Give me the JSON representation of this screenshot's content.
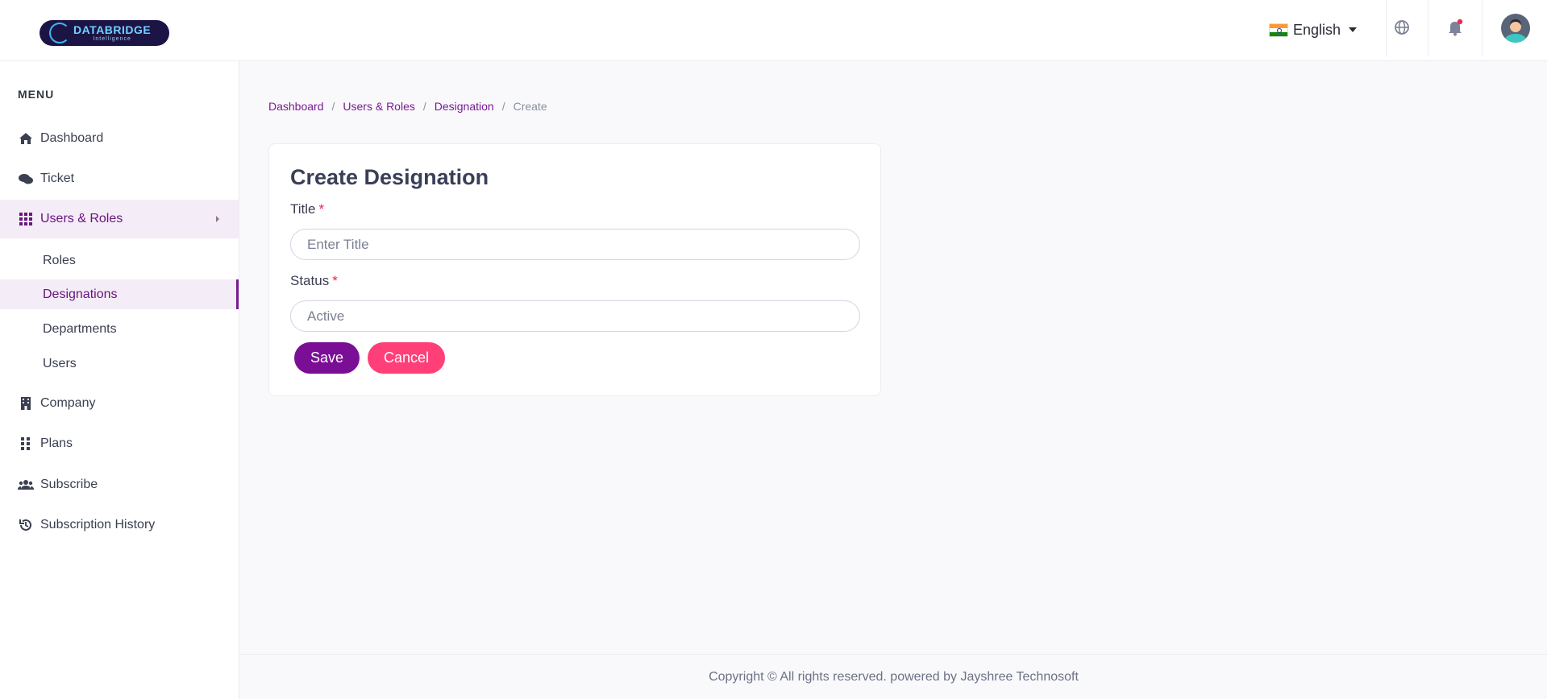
{
  "header": {
    "logo_name": "DATABRIDGE",
    "logo_sub": "Intelligence",
    "language": "English"
  },
  "sidebar": {
    "menu_title": "MENU",
    "items": [
      {
        "label": "Dashboard",
        "icon": "home-icon"
      },
      {
        "label": "Ticket",
        "icon": "comments-icon"
      },
      {
        "label": "Users & Roles",
        "icon": "grid-icon",
        "active": true
      },
      {
        "label": "Company",
        "icon": "building-icon"
      },
      {
        "label": "Plans",
        "icon": "dots-grid-icon"
      },
      {
        "label": "Subscribe",
        "icon": "users-icon"
      },
      {
        "label": "Subscription History",
        "icon": "history-icon"
      }
    ],
    "sub_items": [
      {
        "label": "Roles"
      },
      {
        "label": "Designations",
        "current": true
      },
      {
        "label": "Departments"
      },
      {
        "label": "Users"
      }
    ]
  },
  "breadcrumb": {
    "items": [
      "Dashboard",
      "Users & Roles",
      "Designation"
    ],
    "current": "Create",
    "separator": "/"
  },
  "form": {
    "title": "Create Designation",
    "title_label": "Title",
    "title_placeholder": "Enter Title",
    "status_label": "Status",
    "status_value": "Active",
    "required_mark": "*",
    "save_label": "Save",
    "cancel_label": "Cancel"
  },
  "footer": {
    "text": "Copyright © All rights reserved. powered by Jayshree Technosoft"
  },
  "colors": {
    "primary": "#7a0f95",
    "cancel": "#ff3f78",
    "active_bg": "#f4ecf6",
    "required": "#e9234b"
  }
}
